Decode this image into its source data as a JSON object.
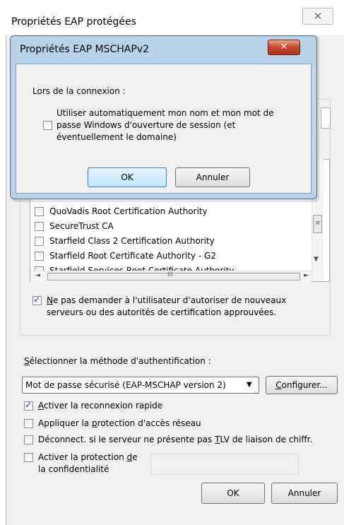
{
  "outer_dialog": {
    "title": "Propriétés EAP protégées",
    "close_glyph": "✕"
  },
  "certificates": [
    {
      "label": "QuoVadis Root Certification Authority",
      "checked": false
    },
    {
      "label": "SecureTrust CA",
      "checked": false
    },
    {
      "label": "Starfield Class 2 Certification Authority",
      "checked": false
    },
    {
      "label": "Starfield Root Certificate Authority - G2",
      "checked": false
    },
    {
      "label": "Starfield Services Root Certificate Authority",
      "checked": false
    }
  ],
  "scroll_glyphs": {
    "grip": "≡",
    "down": "▼",
    "left": "◄",
    "right": "►",
    "hgrip": "III"
  },
  "no_prompt": {
    "checked": true,
    "mnemonic": "N",
    "line1_rest": "e pas demander à l'utilisateur d'autoriser de nouveaux",
    "line2": "serveurs ou des autorités de certification approuvées."
  },
  "auth": {
    "label_mnemonic": "S",
    "label_rest": "électionner la méthode d'authentification :",
    "selected": "Mot de passe sécurisé (EAP-MSCHAP version 2)",
    "arrow": "▼",
    "configure_mnemonic": "C",
    "configure_rest": "onfigurer..."
  },
  "options": {
    "fast_reconnect": {
      "checked": true,
      "mnemonic": "A",
      "rest": "ctiver la reconnexion rapide"
    },
    "nap": {
      "checked": false,
      "pre": "Appliquer la ",
      "mnemonic": "p",
      "post": "rotection d'accès réseau"
    },
    "disconnect_tlv": {
      "checked": false,
      "pre": "Déconnect. si le serveur ne présente pas ",
      "mnemonic": "T",
      "post": "LV de liaison de chiffr."
    },
    "privacy": {
      "checked": false,
      "line1_pre": "Activer la protection ",
      "line1_mnemonic": "d",
      "line1_post": "e",
      "line2": "la confidentialité"
    }
  },
  "outer_buttons": {
    "ok": "OK",
    "cancel": "Annuler"
  },
  "inner_dialog": {
    "title": "Propriétés EAP MSCHAPv2",
    "close_glyph": "✕",
    "on_connect": "Lors de la connexion :",
    "auto_windows": {
      "checked": false,
      "lines": [
        "Utiliser automatiquement mon nom et mon mot de",
        "passe Windows d'ouverture de session (et",
        "éventuellement le domaine)"
      ]
    },
    "ok": "OK",
    "cancel": "Annuler"
  }
}
